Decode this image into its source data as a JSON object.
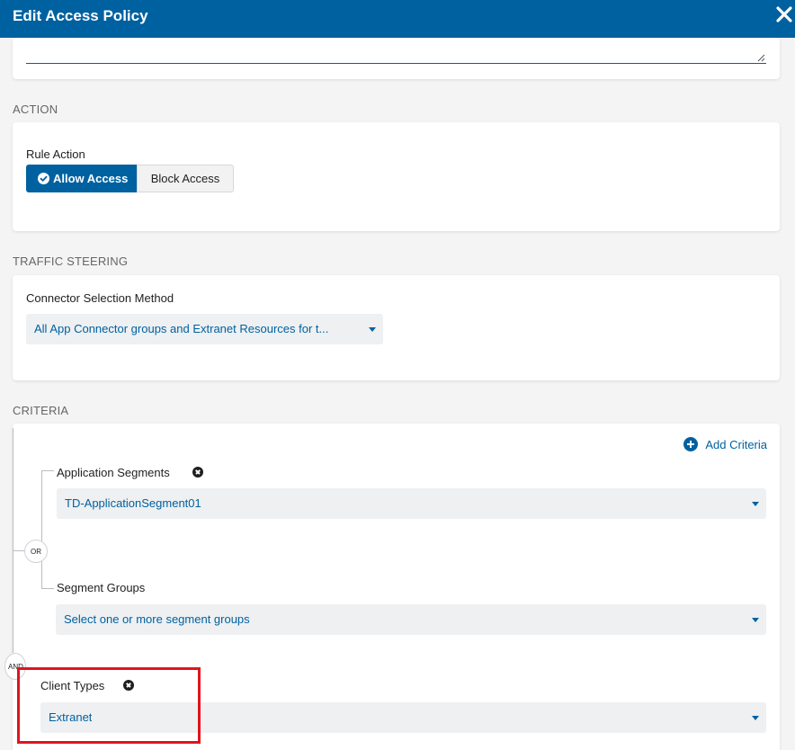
{
  "header": {
    "title": "Edit Access Policy"
  },
  "sections": {
    "action": "ACTION",
    "traffic_steering": "TRAFFIC STEERING",
    "criteria": "CRITERIA"
  },
  "action": {
    "rule_action_label": "Rule Action",
    "allow_label": "Allow Access",
    "block_label": "Block Access"
  },
  "traffic": {
    "connector_label": "Connector Selection Method",
    "connector_value": "All App Connector groups and Extranet Resources for t..."
  },
  "criteria": {
    "add_label": "Add Criteria",
    "or_label": "OR",
    "and_label": "AND",
    "app_segments_label": "Application Segments",
    "app_segments_value": "TD-ApplicationSegment01",
    "segment_groups_label": "Segment Groups",
    "segment_groups_placeholder": "Select one or more segment groups",
    "client_types_label": "Client Types",
    "client_types_value": "Extranet"
  },
  "colors": {
    "brand": "#0061a0",
    "highlight": "#e0141e"
  },
  "icons": [
    "close-icon",
    "check-circle-icon",
    "plus-circle-icon",
    "remove-icon",
    "chevron-down-icon",
    "resize-icon"
  ]
}
